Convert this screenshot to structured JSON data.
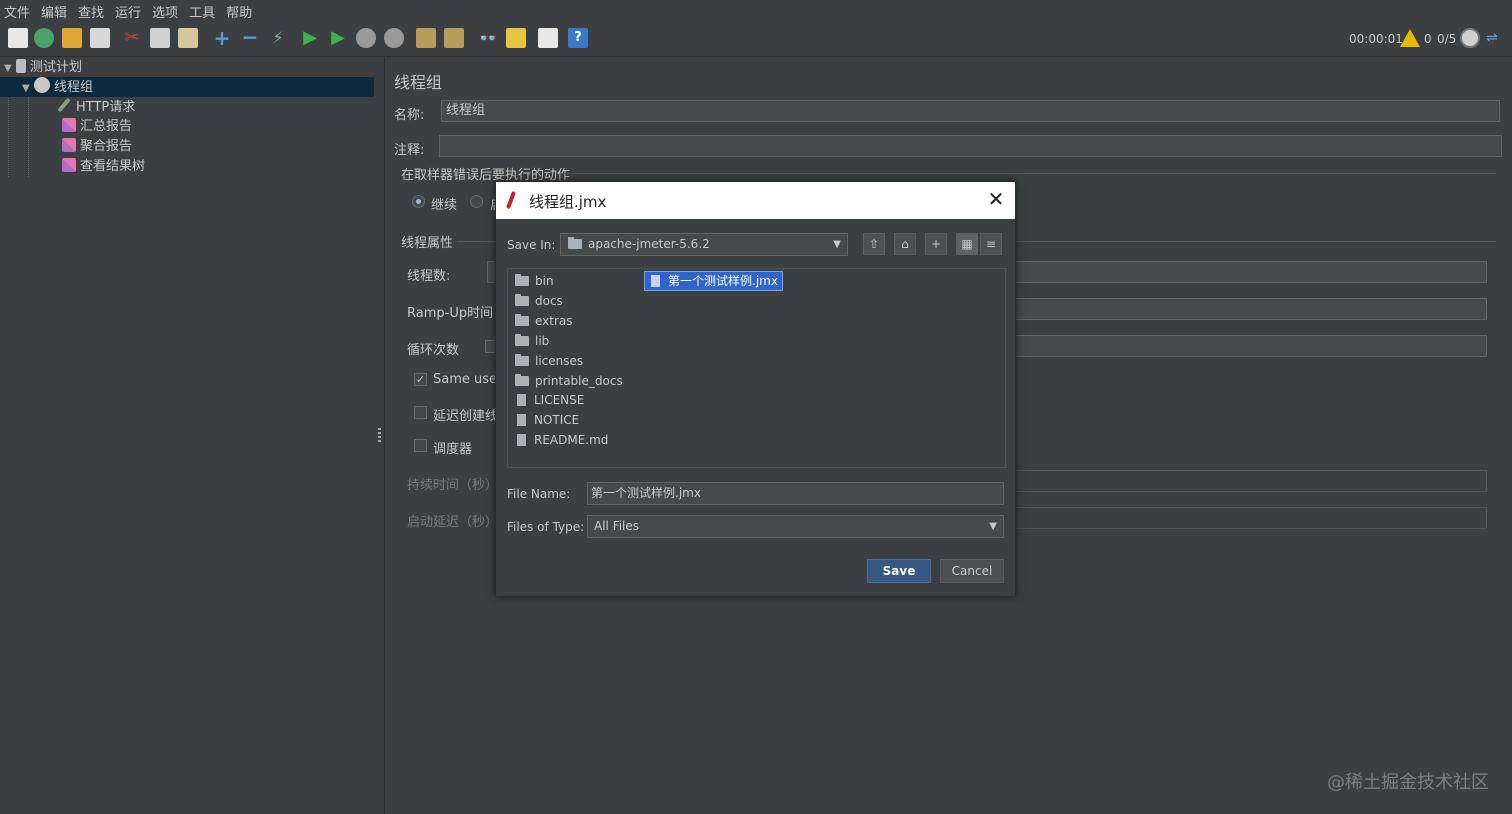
{
  "menu": [
    "文件",
    "编辑",
    "查找",
    "运行",
    "选项",
    "工具",
    "帮助"
  ],
  "toolbar": {
    "timer": "00:00:01",
    "warning_count": "0",
    "thread_count": "0/5",
    "icons": [
      "new-icon",
      "templates-icon",
      "open-icon",
      "save-icon",
      "cut-icon",
      "copy-icon",
      "paste-icon",
      "expand-icon",
      "collapse-icon",
      "toggle-icon",
      "start-icon",
      "start-no-pause-icon",
      "stop-icon",
      "shutdown-icon",
      "clear-icon",
      "clear-all-icon",
      "search-icon",
      "reset-search-icon",
      "function-helper-icon",
      "help-icon"
    ]
  },
  "tree": {
    "items": [
      {
        "label": "测试计划",
        "icon": "test-plan-icon"
      },
      {
        "label": "线程组",
        "icon": "gear-icon"
      },
      {
        "label": "HTTP请求",
        "icon": "http-request-icon"
      },
      {
        "label": "汇总报告",
        "icon": "report-icon"
      },
      {
        "label": "聚合报告",
        "icon": "report-icon"
      },
      {
        "label": "查看结果树",
        "icon": "report-icon"
      }
    ]
  },
  "panel": {
    "title": "线程组",
    "name_label": "名称:",
    "name_value": "线程组",
    "comment_label": "注释:",
    "comment_value": "",
    "error_action_legend": "在取样器错误后要执行的动作",
    "error_action_continue": "继续",
    "error_action_next": "启",
    "thread_props_legend": "线程属性",
    "threads_label": "线程数:",
    "rampup_label": "Ramp-Up时间（",
    "loop_label": "循环次数",
    "same_user_label": "Same user o",
    "delay_create_label": "延迟创建线程",
    "scheduler_label": "调度器",
    "duration_label": "持续时间（秒）",
    "startup_delay_label": "启动延迟（秒）"
  },
  "dialog": {
    "title": "线程组.jmx",
    "save_in_label": "Save In:",
    "save_in_value": "apache-jmeter-5.6.2",
    "files": [
      {
        "name": "bin",
        "type": "folder"
      },
      {
        "name": "docs",
        "type": "folder"
      },
      {
        "name": "extras",
        "type": "folder"
      },
      {
        "name": "lib",
        "type": "folder"
      },
      {
        "name": "licenses",
        "type": "folder"
      },
      {
        "name": "printable_docs",
        "type": "folder"
      },
      {
        "name": "LICENSE",
        "type": "file"
      },
      {
        "name": "NOTICE",
        "type": "file"
      },
      {
        "name": "README.md",
        "type": "file"
      }
    ],
    "selected_file": "第一个测试样例.jmx",
    "file_name_label": "File Name:",
    "file_name_value": "第一个测试样例.jmx",
    "files_of_type_label": "Files of Type:",
    "files_of_type_value": "All Files",
    "save_button": "Save",
    "cancel_button": "Cancel"
  },
  "watermark": "@稀土掘金技术社区"
}
